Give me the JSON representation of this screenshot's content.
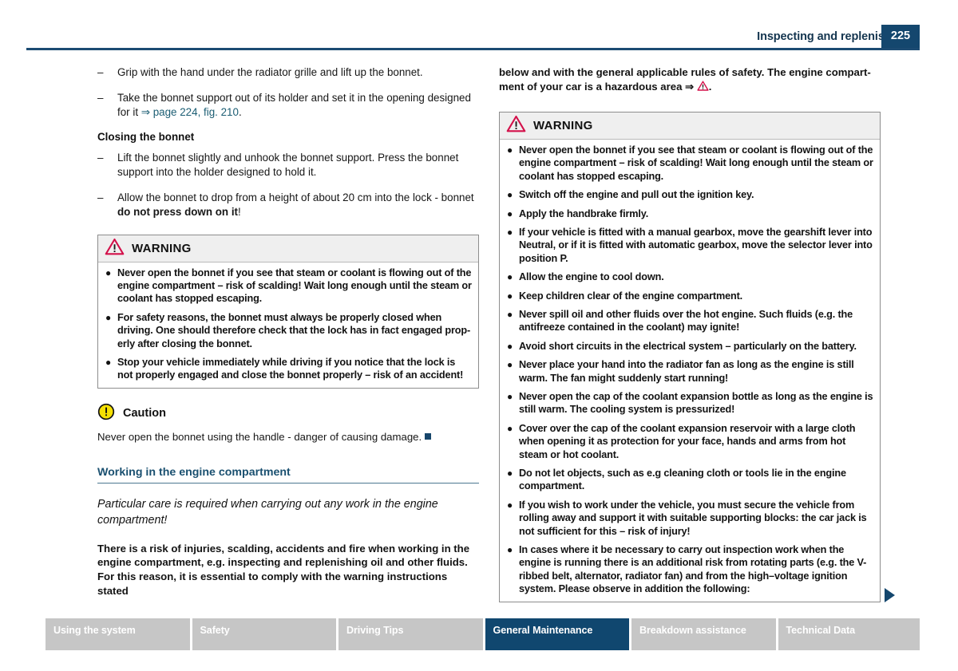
{
  "header": {
    "title": "Inspecting and replenishing",
    "page_number": "225"
  },
  "left_column": {
    "steps": [
      {
        "dash": "–",
        "text": "Grip with the hand under the radiator grille and lift up the bonnet."
      }
    ],
    "step_with_ref": {
      "dash": "–",
      "text_before": "Take the bonnet support out of its holder and set it in the opening designed for it ",
      "arrow": "⇒",
      "ref": " page 224, fig. 210",
      "text_after": "."
    },
    "closing_heading": "Closing the bonnet",
    "closing_steps": [
      {
        "dash": "–",
        "text": "Lift the bonnet slightly and unhook the bonnet support. Press the bonnet support into the holder designed to hold it."
      }
    ],
    "drop_step": {
      "dash": "–",
      "text_before": "Allow the bonnet to drop from a height of about 20 cm into the lock - bonnet ",
      "bold": "do not press down on it",
      "text_after": "!"
    },
    "warning": {
      "label": "WARNING",
      "icon": "warning-triangle-icon",
      "bullets": [
        "Never open the bonnet if you see that steam or coolant is flowing out of the engine compartment – risk of scalding! Wait long enough until the steam or coolant has stopped escaping.",
        "For safety reasons, the bonnet must always be properly closed when driving. One should therefore check that the lock has in fact engaged prop-erly after closing the bonnet.",
        "Stop your vehicle immediately while driving if you notice that the lock is not properly engaged and close the bonnet properly – risk of an accident!"
      ]
    },
    "caution": {
      "label": "Caution",
      "icon": "caution-circle-icon",
      "text": "Never open the bonnet using the handle - danger of causing damage."
    },
    "section_heading": "Working in the engine compartment",
    "intro_italic": "Particular care is required when carrying out any work in the engine compartment!",
    "intro_bold": "There is a risk of injuries, scalding, accidents and fire when working in the engine compartment, e.g. inspecting and replenishing oil and other fluids. For this reason, it is essential to comply with the warning instructions stated"
  },
  "right_column": {
    "continuation": {
      "text_before": "below and with the general applicable rules of safety. The engine compart-ment of your car is a hazardous area ",
      "arrow": "⇒",
      "text_after": "."
    },
    "warning": {
      "label": "WARNING",
      "icon": "warning-triangle-icon",
      "bullets": [
        "Never open the bonnet if you see that steam or coolant is flowing out of the engine compartment – risk of scalding! Wait long enough until the steam or coolant has stopped escaping.",
        "Switch off the engine and pull out the ignition key.",
        "Apply the handbrake firmly.",
        "If your vehicle is fitted with a manual gearbox, move the gearshift lever into Neutral, or if it is fitted with automatic gearbox, move the selector lever into position P.",
        "Allow the engine to cool down.",
        "Keep children clear of the engine compartment.",
        "Never spill oil and other fluids over the hot engine. Such fluids (e.g. the antifreeze contained in the coolant) may ignite!",
        "Avoid short circuits in the electrical system – particularly on the battery.",
        "Never place your hand into the radiator fan as long as the engine is still warm. The fan might suddenly start running!",
        "Never open the cap of the coolant expansion bottle as long as the engine is still warm. The cooling system is pressurized!",
        "Cover over the cap of the coolant expansion reservoir with a large cloth when opening it as protection for your face, hands and arms from hot steam or hot coolant.",
        "Do not let objects, such as e.g cleaning cloth or tools lie in the engine compartment.",
        "If you wish to work under the vehicle, you must secure the vehicle from rolling away and support it with suitable supporting blocks: the car jack is not sufficient for this – risk of injury!",
        "In cases where it be necessary to carry out inspection work when the engine is running there is an additional risk from rotating parts (e.g. the V-ribbed belt, alternator, radiator fan) and from the high–voltage ignition system. Please observe in addition the following:"
      ]
    }
  },
  "footer_nav": {
    "tabs": [
      {
        "label": "Using the system",
        "active": false
      },
      {
        "label": "Safety",
        "active": false
      },
      {
        "label": "Driving Tips",
        "active": false
      },
      {
        "label": "General Maintenance",
        "active": true
      },
      {
        "label": "Breakdown assistance",
        "active": false
      },
      {
        "label": "Technical Data",
        "active": false
      }
    ]
  },
  "colors": {
    "brand_blue": "#14476e",
    "heading_blue": "#1a5070",
    "warning_red": "#d3104a",
    "caution_yellow": "#f5e003",
    "tab_inactive": "#c6c6c6"
  }
}
